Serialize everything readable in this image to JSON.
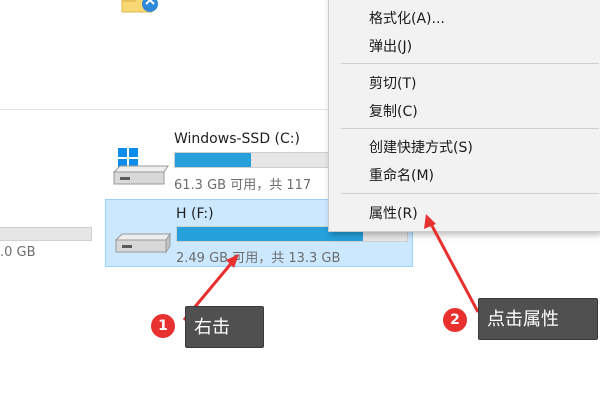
{
  "drives": [
    {
      "title": "Windows-SSD (C:)",
      "info": "61.3 GB 可用，共 117",
      "used_fraction": 0.48,
      "icon": "windows-drive-icon"
    },
    {
      "title": "H (F:)",
      "info": "2.49 GB 可用，共 13.3 GB",
      "used_fraction": 0.81,
      "icon": "drive-icon"
    }
  ],
  "partial_drive": {
    "info": ".0 GB"
  },
  "context_menu": {
    "items": [
      {
        "label": "格式化(A)..."
      },
      {
        "label": "弹出(J)"
      },
      {
        "label": "剪切(T)"
      },
      {
        "label": "复制(C)"
      },
      {
        "label": "创建快捷方式(S)"
      },
      {
        "label": "重命名(M)"
      },
      {
        "label": "属性(R)"
      }
    ]
  },
  "annotations": [
    {
      "number": "1",
      "text": "右击"
    },
    {
      "number": "2",
      "text": "点击属性"
    }
  ],
  "colors": {
    "selection_bg": "#cce8ff",
    "bar_fill": "#26a0da",
    "badge": "#e8302f",
    "arrow": "#e8302f",
    "tooltip_bg": "#505050"
  }
}
